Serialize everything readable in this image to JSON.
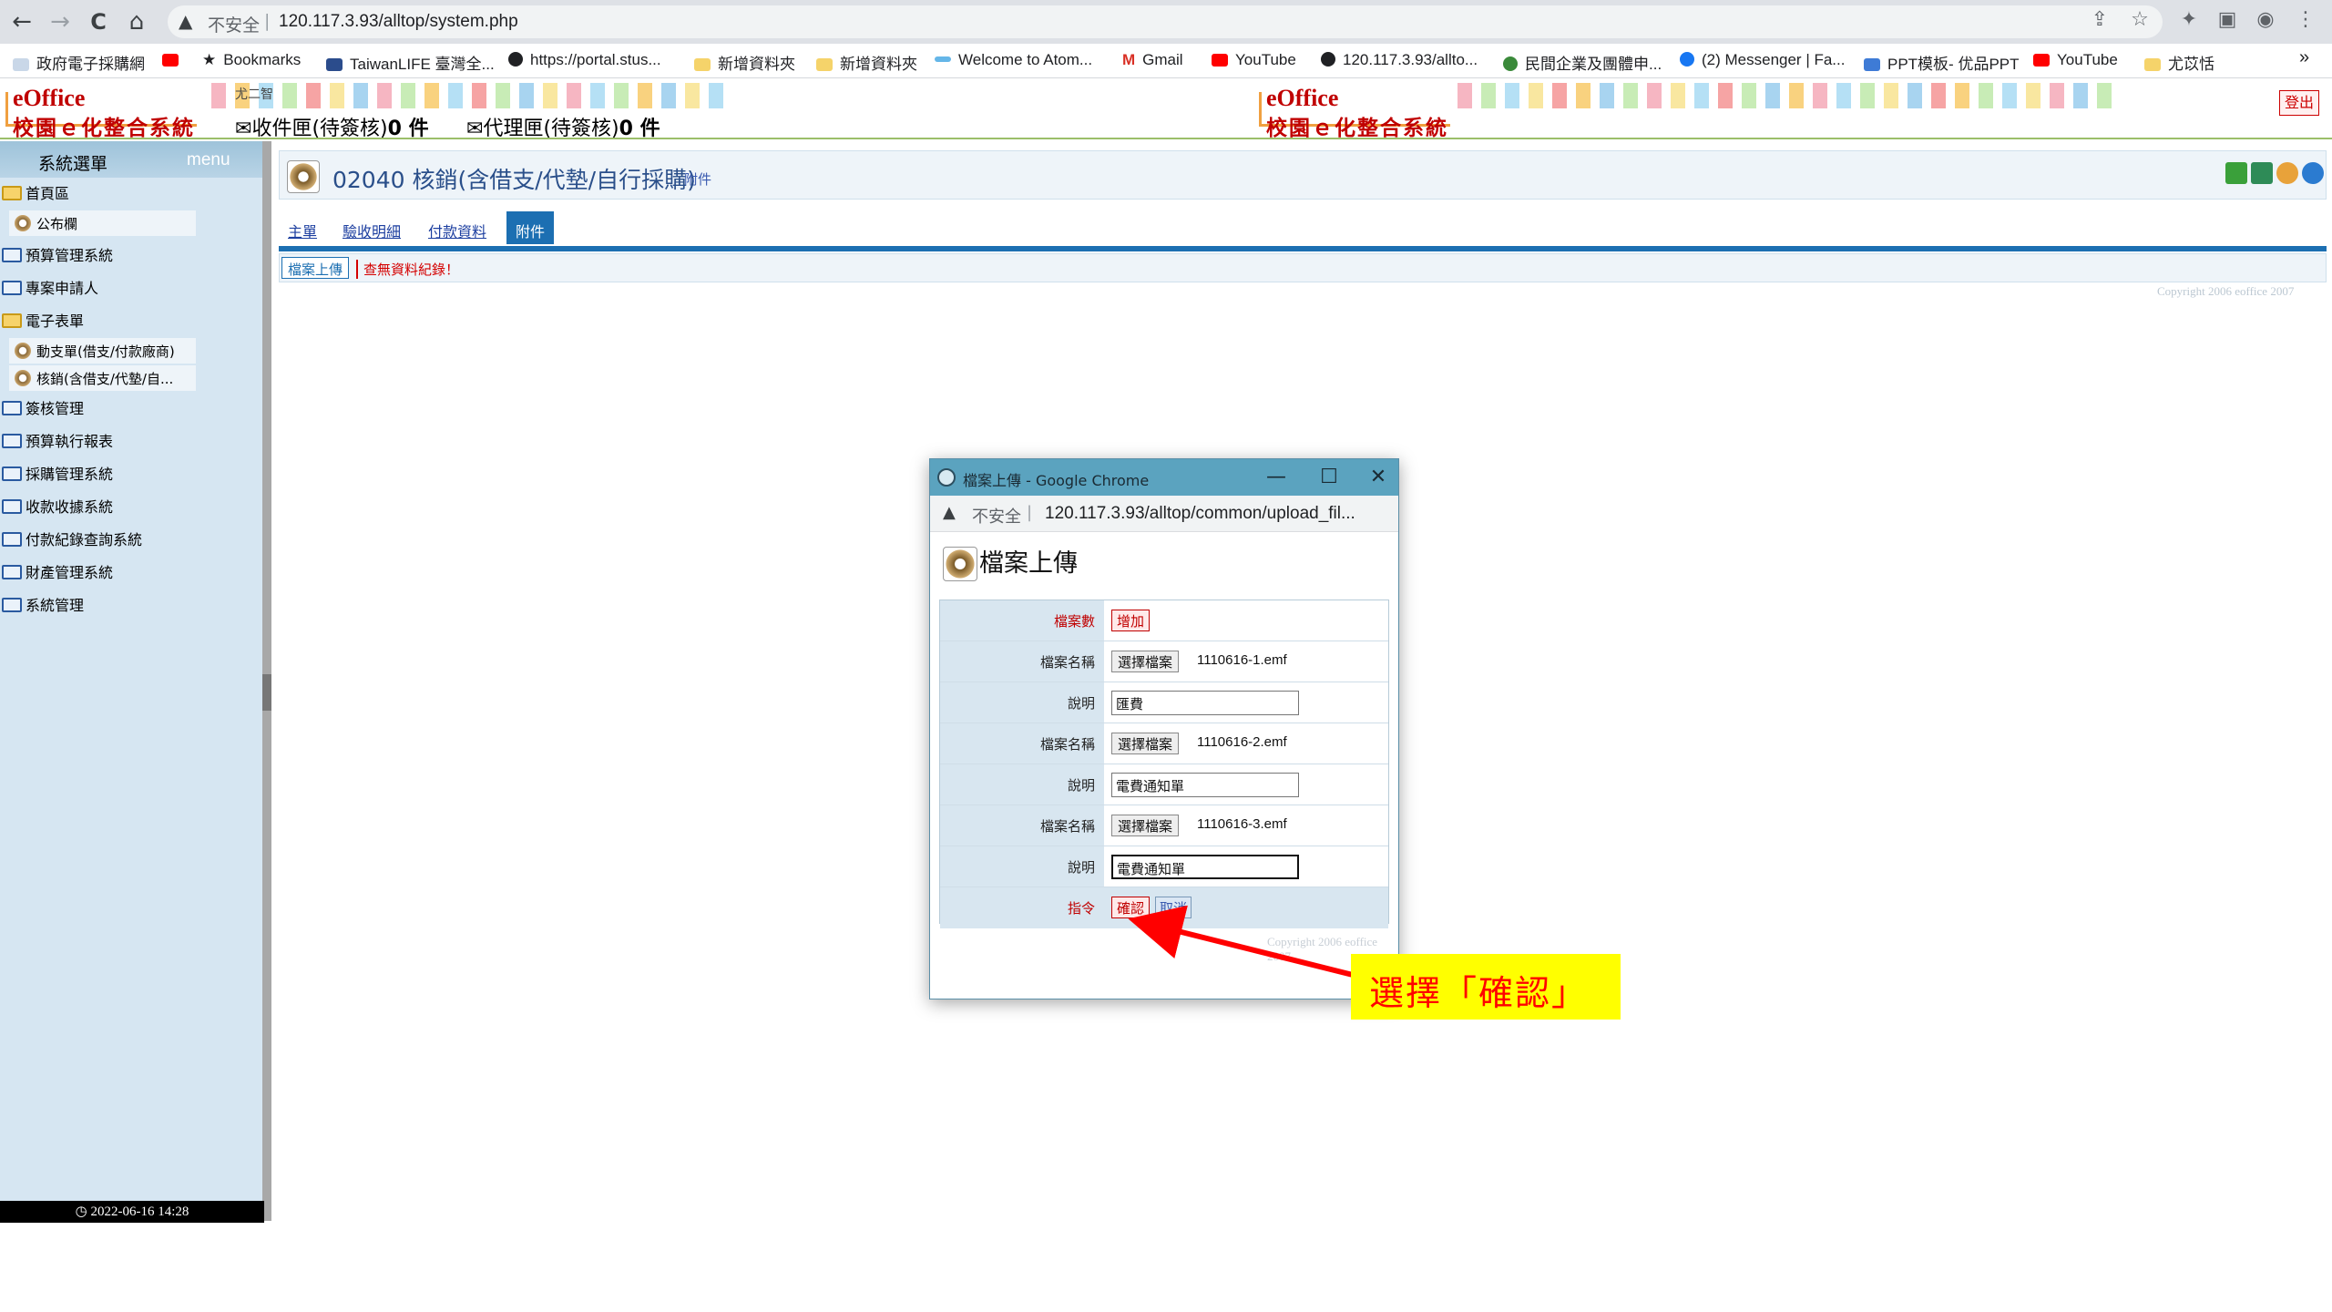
{
  "browser": {
    "nav": {
      "back": "←",
      "forward": "→",
      "reload": "C",
      "home": "⌂"
    },
    "omnibox": {
      "warning_icon": "▲",
      "insecure": "不安全",
      "separator": "|",
      "url": "120.117.3.93/alltop/system.php"
    },
    "bookmarks": [
      "政府電子採購網",
      "Bookmarks",
      "TaiwanLIFE 臺灣全...",
      "https://portal.stus...",
      "新增資料夾",
      "新增資料夾",
      "Welcome to Atom...",
      "Gmail",
      "YouTube",
      "120.117.3.93/allto...",
      "民間企業及團體申...",
      "(2) Messenger | Fa...",
      "PPT模板- 优品PPT",
      "YouTube",
      "尤苡恬"
    ],
    "more": "»"
  },
  "eoffice": {
    "logo_top": "eOffice",
    "logo_sub": "校園ｅ化整合系統",
    "inbox_label": "收件匣(待簽核)",
    "inbox_count": "0 件",
    "proxy_label": "代理匣(待簽核)",
    "proxy_count": "0 件",
    "mail_icon": "✉",
    "user_tiny": "尤二智",
    "logout": "登出"
  },
  "sidebar": {
    "title": "系統選單",
    "menu": "menu",
    "items": [
      {
        "label": "首頁區",
        "type": "folder-open"
      },
      {
        "label": "公布欄",
        "type": "sub"
      },
      {
        "label": "預算管理系統",
        "type": "folder"
      },
      {
        "label": "專案申請人",
        "type": "folder"
      },
      {
        "label": "電子表單",
        "type": "folder-open"
      },
      {
        "label": "動支單(借支/付款廠商)",
        "type": "sub"
      },
      {
        "label": "核銷(含借支/代墊/自...",
        "type": "sub"
      },
      {
        "label": "簽核管理",
        "type": "folder"
      },
      {
        "label": "預算執行報表",
        "type": "folder"
      },
      {
        "label": "採購管理系統",
        "type": "folder"
      },
      {
        "label": "收款收據系統",
        "type": "folder"
      },
      {
        "label": "付款紀錄查詢系統",
        "type": "folder"
      },
      {
        "label": "財產管理系統",
        "type": "folder"
      },
      {
        "label": "系統管理",
        "type": "folder"
      }
    ],
    "datetime": "2022-06-16 14:28"
  },
  "form": {
    "title": "02040 核銷(含借支/代墊/自行採購)",
    "title_sub": "附件",
    "tabs": [
      "主單",
      "驗收明細",
      "付款資料",
      "附件"
    ],
    "active_tab": "附件",
    "upload_link": "檔案上傳",
    "no_data": "查無資料紀錄！",
    "copyright": "Copyright 2006 eoffice 2007"
  },
  "popup": {
    "window_title": "檔案上傳 - Google Chrome",
    "min": "—",
    "max": "☐",
    "close": "✕",
    "address_warning": "▲",
    "address_insecure": "不安全",
    "address_sep": "|",
    "address_url": "120.117.3.93/alltop/common/upload_fil...",
    "heading": "檔案上傳",
    "rows": {
      "count_label": "檔案數",
      "add_button": "增加",
      "file_label": "檔案名稱",
      "choose_button": "選擇檔案",
      "desc_label": "說明",
      "cmd_label": "指令",
      "confirm_button": "確認",
      "cancel_button": "取消"
    },
    "files": [
      {
        "name": "1110616-1.emf",
        "desc": "匯費"
      },
      {
        "name": "1110616-2.emf",
        "desc": "電費通知單"
      },
      {
        "name": "1110616-3.emf",
        "desc": "電費通知單"
      }
    ],
    "copyright": "Copyright 2006 eoffice 2007"
  },
  "annotation": {
    "text": "選擇「確認」",
    "bg_color": "#ffff00",
    "text_color": "#ff0000",
    "arrow_color": "#ff0000"
  }
}
